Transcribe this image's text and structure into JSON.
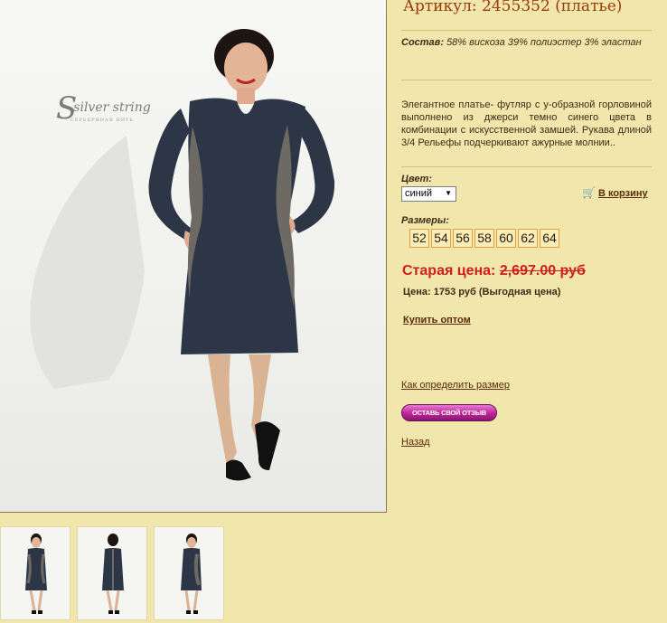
{
  "product": {
    "title": "Артикул: 2455352 (платье)",
    "composition_label": "Состав:",
    "composition_value": "58% вискоза 39% полиэстер 3% эластан",
    "description": "Элегантное платье- футляр с у-образной горловиной выполнено из джерси темно синего цвета в комбинации с искусственной замшей. Рукава длиной 3/4 Рельефы подчеркивают ажурные молнии..",
    "color_label": "Цвет:",
    "color_selected": "синий",
    "cart_label": "В корзину",
    "sizes_label": "Размеры:",
    "sizes": [
      "52",
      "54",
      "56",
      "58",
      "60",
      "62",
      "64"
    ],
    "old_price_label": "Старая цена:",
    "old_price_value": "2,697.00 руб",
    "price_text": "Цена: 1753 руб (Выгодная цена)",
    "wholesale_link": "Купить оптом",
    "size_help_link": "Как определить размер",
    "review_button": "ОСТАВЬ СВОЙ ОТЗЫВ",
    "back_link": "Назад"
  },
  "photo": {
    "brand_text": "silver string",
    "brand_sub": "СЕРЕБРЯНАЯ НИТЬ"
  },
  "colors": {
    "background": "#f1e6ab",
    "title": "#9a3a0c",
    "old_price": "#d11f17",
    "dress": "#2d3646",
    "review_button": "#c0299c"
  },
  "icons": {
    "cart": "cart-icon",
    "select_arrow": "chevron-down-icon"
  }
}
